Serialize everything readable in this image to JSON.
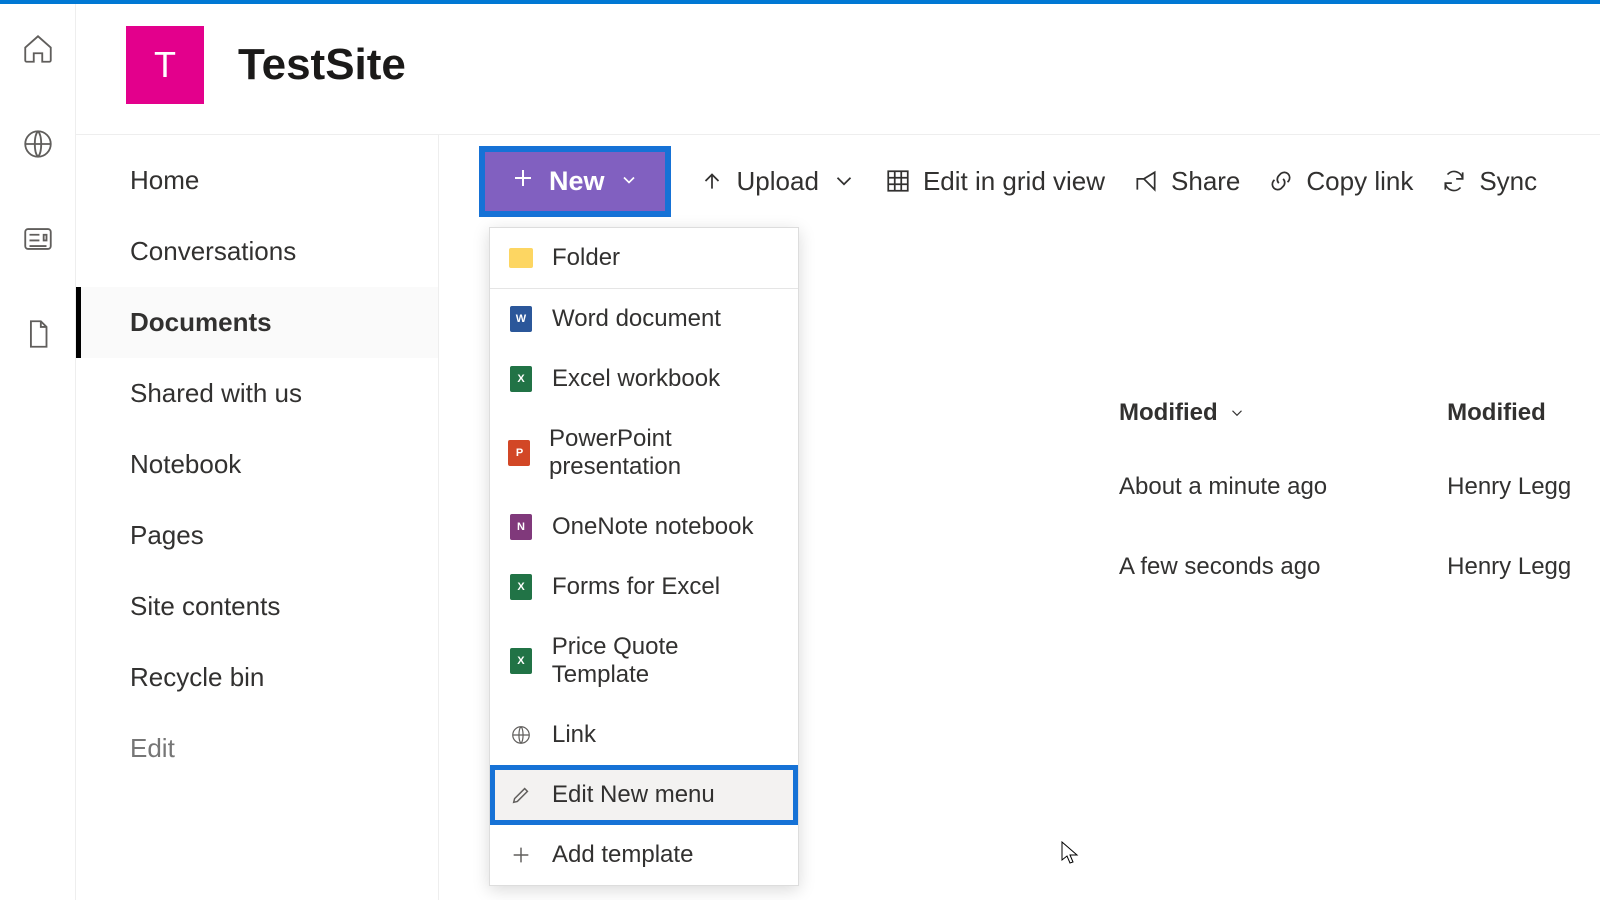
{
  "site": {
    "logo_initial": "T",
    "title": "TestSite"
  },
  "leftrail": [
    "home",
    "globe",
    "news",
    "doc"
  ],
  "sidenav": {
    "items": [
      {
        "label": "Home"
      },
      {
        "label": "Conversations"
      },
      {
        "label": "Documents",
        "active": true
      },
      {
        "label": "Shared with us"
      },
      {
        "label": "Notebook"
      },
      {
        "label": "Pages"
      },
      {
        "label": "Site contents"
      },
      {
        "label": "Recycle bin"
      }
    ],
    "edit_label": "Edit"
  },
  "commandbar": {
    "new_label": "New",
    "upload_label": "Upload",
    "grid_label": "Edit in grid view",
    "share_label": "Share",
    "copy_label": "Copy link",
    "sync_label": "Sync"
  },
  "new_menu": {
    "items": [
      {
        "icon": "folder",
        "label": "Folder"
      },
      {
        "icon": "word",
        "label": "Word document"
      },
      {
        "icon": "excel",
        "label": "Excel workbook"
      },
      {
        "icon": "pp",
        "label": "PowerPoint presentation"
      },
      {
        "icon": "onenote",
        "label": "OneNote notebook"
      },
      {
        "icon": "excel",
        "label": "Forms for Excel"
      },
      {
        "icon": "excel",
        "label": "Price Quote Template"
      },
      {
        "icon": "link",
        "label": "Link"
      },
      {
        "icon": "pencil",
        "label": "Edit New menu",
        "highlight": true
      },
      {
        "icon": "plus",
        "label": "Add template"
      }
    ]
  },
  "listview": {
    "columns": {
      "modified": "Modified",
      "modified_by": "Modified"
    },
    "rows": [
      {
        "modified": "About a minute ago",
        "modified_by": "Henry Legg"
      },
      {
        "modified": "A few seconds ago",
        "modified_by": "Henry Legg"
      }
    ]
  }
}
